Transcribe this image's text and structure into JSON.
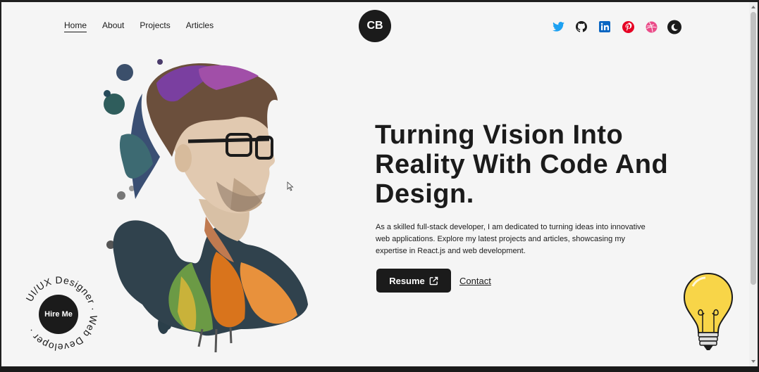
{
  "nav": {
    "items": [
      {
        "label": "Home",
        "active": true
      },
      {
        "label": "About",
        "active": false
      },
      {
        "label": "Projects",
        "active": false
      },
      {
        "label": "Articles",
        "active": false
      }
    ]
  },
  "logo": {
    "text": "CB"
  },
  "socials": [
    {
      "icon": "twitter-icon",
      "color": "#1da1f2"
    },
    {
      "icon": "github-icon",
      "color": "#1b1b1b"
    },
    {
      "icon": "linkedin-icon",
      "color": "#0a66c2"
    },
    {
      "icon": "pinterest-icon",
      "color": "#e60023"
    },
    {
      "icon": "dribbble-icon",
      "color": "#ea4c89"
    },
    {
      "icon": "theme-toggle-icon",
      "color": "#1b1b1b"
    }
  ],
  "hero": {
    "headline": "Turning Vision Into Reality With Code And Design.",
    "intro": "As a skilled full-stack developer, I am dedicated to turning ideas into innovative web applications. Explore my latest projects and articles, showcasing my expertise in React.js and web development.",
    "resume_label": "Resume",
    "contact_label": "Contact"
  },
  "hire": {
    "button_label": "Hire Me",
    "ring_text": "UI/UX Designer · Web Developer · "
  },
  "colors": {
    "dark": "#1b1b1b",
    "background": "#f5f5f5",
    "bulb": "#f8d548"
  }
}
